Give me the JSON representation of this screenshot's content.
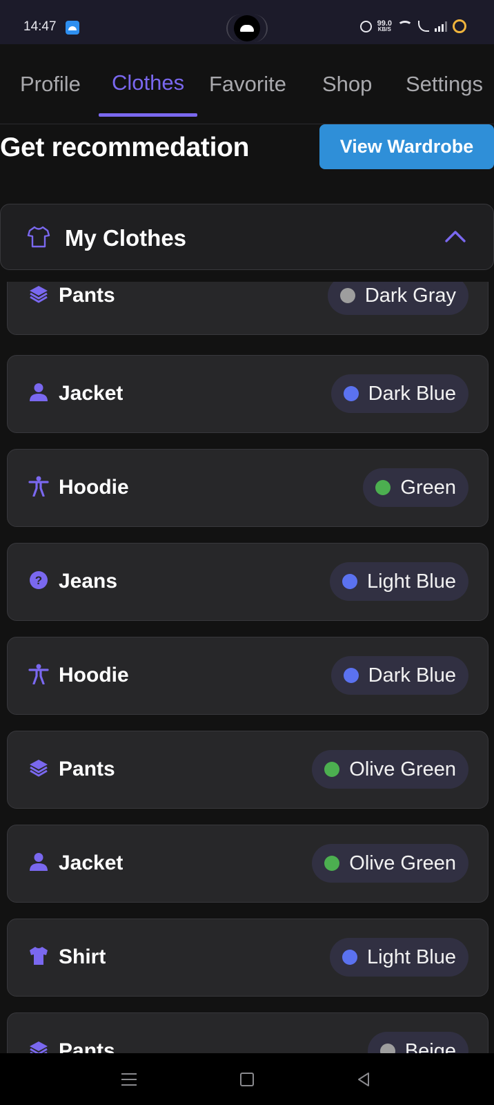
{
  "status_bar": {
    "time": "14:47",
    "speed_value": "99.0",
    "speed_unit": "KB/S"
  },
  "tabs": [
    {
      "label": "Profile",
      "active": false
    },
    {
      "label": "Clothes",
      "active": true
    },
    {
      "label": "Favorite",
      "active": false
    },
    {
      "label": "Shop",
      "active": false
    },
    {
      "label": "Settings",
      "active": false
    }
  ],
  "header": {
    "title": "Get recommedation",
    "view_wardrobe_label": "View Wardrobe"
  },
  "section": {
    "title": "My Clothes",
    "expanded": true
  },
  "items": [
    {
      "name": "Pants",
      "icon": "layers-icon",
      "color_name": "Dark Gray",
      "color": "#9e9e9e"
    },
    {
      "name": "Jacket",
      "icon": "person-icon",
      "color_name": "Dark Blue",
      "color": "#5b72f0"
    },
    {
      "name": "Hoodie",
      "icon": "accessibility-icon",
      "color_name": "Green",
      "color": "#4caf50"
    },
    {
      "name": "Jeans",
      "icon": "help-icon",
      "color_name": "Light Blue",
      "color": "#5b72f0"
    },
    {
      "name": "Hoodie",
      "icon": "accessibility-icon",
      "color_name": "Dark Blue",
      "color": "#5b72f0"
    },
    {
      "name": "Pants",
      "icon": "layers-icon",
      "color_name": "Olive Green",
      "color": "#4caf50"
    },
    {
      "name": "Jacket",
      "icon": "person-icon",
      "color_name": "Olive Green",
      "color": "#4caf50"
    },
    {
      "name": "Shirt",
      "icon": "shirt-icon",
      "color_name": "Light Blue",
      "color": "#5b72f0"
    },
    {
      "name": "Pants",
      "icon": "layers-icon",
      "color_name": "Beige",
      "color": "#9e9e9e"
    }
  ],
  "theme": {
    "accent": "#7a68ef",
    "button": "#2f8fd8"
  }
}
